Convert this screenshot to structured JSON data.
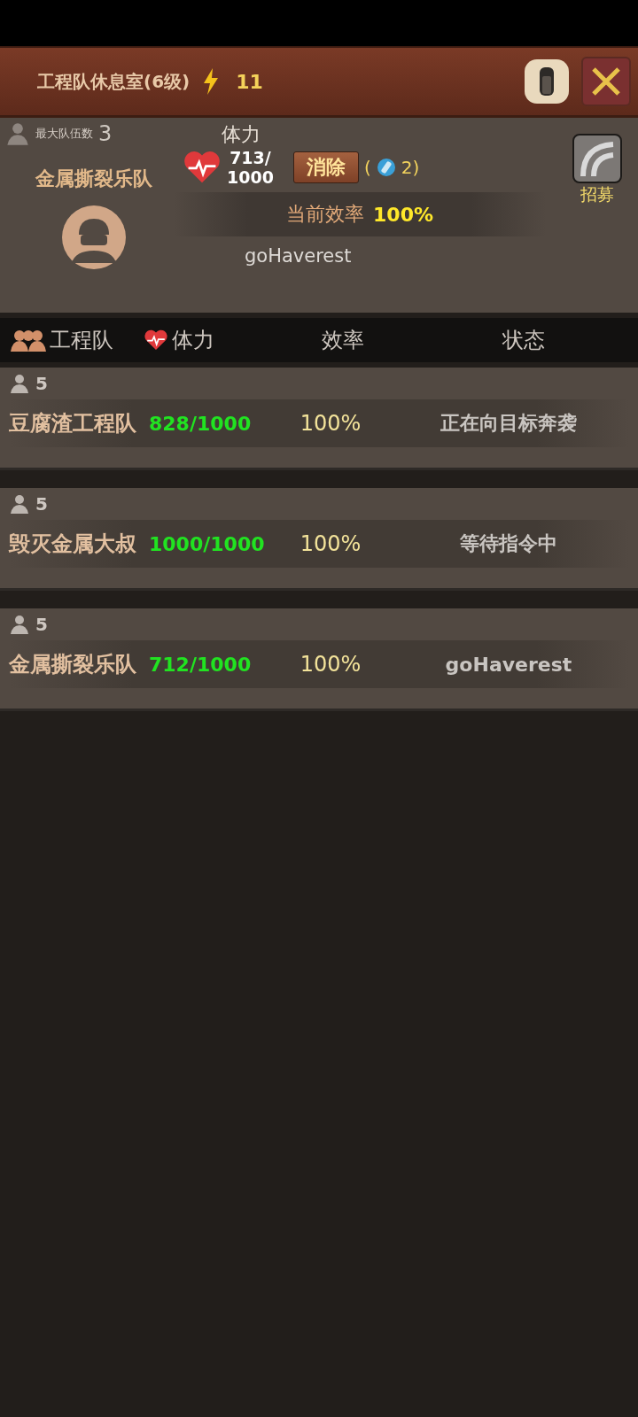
{
  "window": {
    "title": "工程队休息室(6级)",
    "energy": "11"
  },
  "info": {
    "max_teams_label": "最大队伍数",
    "max_teams": "3",
    "team_name": "金属撕裂乐队",
    "stamina_label": "体力",
    "stamina": "713/",
    "stamina_max": "1000",
    "clear_button": "消除",
    "cost_open": "(",
    "cost": "2)",
    "recruit_label": "招募",
    "efficiency_label": "当前效率",
    "efficiency": "100%",
    "status": "goHaverest"
  },
  "table": {
    "columns": [
      "工程队",
      "体力",
      "效率",
      "状态"
    ],
    "rows": [
      {
        "members": "5",
        "name": "豆腐渣工程队",
        "stamina": "828/1000",
        "efficiency": "100%",
        "status": "正在向目标奔袭"
      },
      {
        "members": "5",
        "name": "毁灭金属大叔",
        "stamina": "1000/1000",
        "efficiency": "100%",
        "status": "等待指令中"
      },
      {
        "members": "5",
        "name": "金属撕裂乐队",
        "stamina": "712/1000",
        "efficiency": "100%",
        "status": "goHaverest"
      }
    ]
  }
}
